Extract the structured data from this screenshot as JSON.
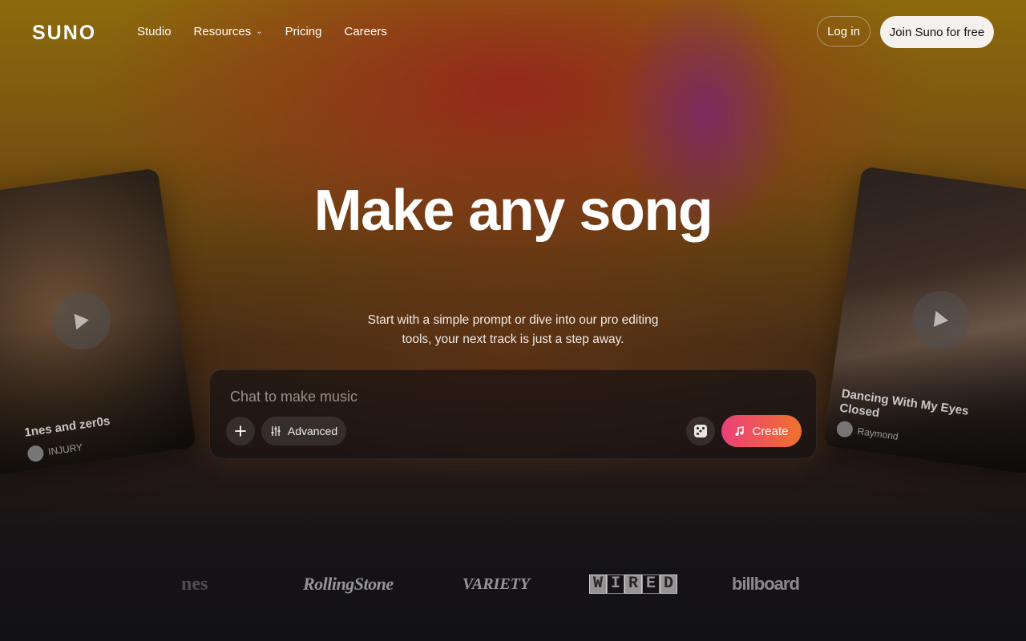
{
  "brand": {
    "logo_text": "SUNO"
  },
  "nav": {
    "links": [
      {
        "label": "Studio"
      },
      {
        "label": "Resources",
        "has_dropdown": true
      },
      {
        "label": "Pricing"
      },
      {
        "label": "Careers"
      }
    ],
    "login_label": "Log in",
    "join_label": "Join Suno for free"
  },
  "hero": {
    "title": "Make any song",
    "subtitle_line1": "Start with a simple prompt or dive into our pro editing",
    "subtitle_line2": "tools, your next track is just a step away."
  },
  "prompt": {
    "placeholder": "Chat to make music",
    "advanced_label": "Advanced",
    "create_label": "Create",
    "add_icon": "plus-icon",
    "dice_icon": "dice-icon"
  },
  "cards": {
    "left": {
      "title": "1nes and zer0s",
      "artist": "INJURY"
    },
    "right": {
      "title": "Dancing With My Eyes Closed",
      "artist": "Raymond"
    }
  },
  "press": {
    "times": "nes",
    "rolling_stone": "RollingStone",
    "variety": "VARIETY",
    "wired": [
      "W",
      "I",
      "R",
      "E",
      "D"
    ],
    "billboard": "billboard"
  },
  "colors": {
    "accent_gradient_start": "#e9417a",
    "accent_gradient_end": "#f0722e",
    "join_bg": "#f4f1ee"
  }
}
